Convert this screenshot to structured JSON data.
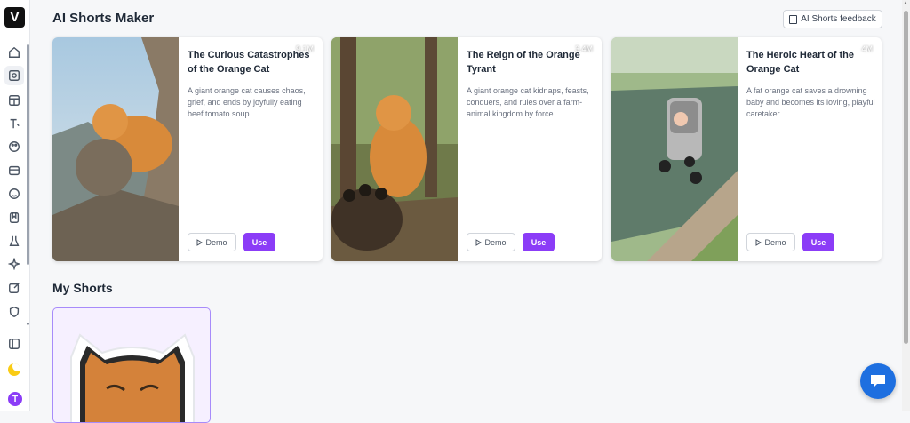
{
  "app": {
    "logo_letter": "V",
    "user_initial": "T"
  },
  "header": {
    "title": "AI Shorts Maker",
    "feedback_label": "AI Shorts feedback"
  },
  "sidebar": {
    "icons": [
      "home-icon",
      "video-plus-icon",
      "template-icon",
      "text-icon",
      "palette-icon",
      "media-icon",
      "face-icon",
      "library-icon",
      "flask-icon",
      "sparkle-icon",
      "edit-icon",
      "shield-icon"
    ],
    "bottom_icons": [
      "panel-toggle-icon",
      "moon-icon"
    ]
  },
  "cards": [
    {
      "title": "The Curious Catastrophes of the Orange Cat",
      "description": "A giant orange cat causes chaos, grief, and ends by joyfully eating beef tomato soup.",
      "plays": "9.1M",
      "demo_label": "Demo",
      "use_label": "Use"
    },
    {
      "title": "The Reign of the Orange Tyrant",
      "description": "A giant orange cat kidnaps, feasts, conquers, and rules over a farm-animal kingdom by force.",
      "plays": "3.4M",
      "demo_label": "Demo",
      "use_label": "Use"
    },
    {
      "title": "The Heroic Heart of the Orange Cat",
      "description": "A fat orange cat saves a drowning baby and becomes its loving, playful caretaker.",
      "plays": "4M",
      "demo_label": "Demo",
      "use_label": "Use"
    }
  ],
  "my_shorts": {
    "title": "My Shorts"
  },
  "colors": {
    "accent": "#8b3cf7",
    "chat": "#1e6fe0"
  }
}
